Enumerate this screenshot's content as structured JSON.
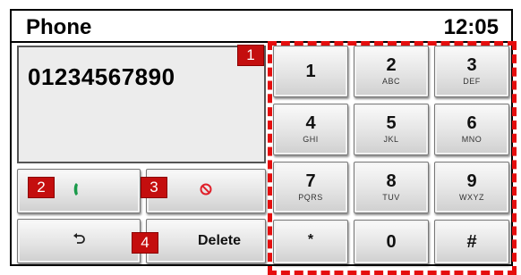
{
  "header": {
    "title": "Phone",
    "clock": "12:05"
  },
  "display": {
    "number": "01234567890"
  },
  "keypad": {
    "keys": [
      {
        "digit": "1",
        "letters": ""
      },
      {
        "digit": "2",
        "letters": "ABC"
      },
      {
        "digit": "3",
        "letters": "DEF"
      },
      {
        "digit": "4",
        "letters": "GHI"
      },
      {
        "digit": "5",
        "letters": "JKL"
      },
      {
        "digit": "6",
        "letters": "MNO"
      },
      {
        "digit": "7",
        "letters": "PQRS"
      },
      {
        "digit": "8",
        "letters": "TUV"
      },
      {
        "digit": "9",
        "letters": "WXYZ"
      },
      {
        "digit": "*",
        "letters": ""
      },
      {
        "digit": "0",
        "letters": ""
      },
      {
        "digit": "#",
        "letters": ""
      }
    ]
  },
  "controls": {
    "call_icon": "phone-handset-icon",
    "call_color": "#1a9a4a",
    "hangup_icon": "no-entry-icon",
    "hangup_color": "#e0202a",
    "back_icon": "undo-arrow-icon",
    "delete_label": "Delete"
  },
  "markers": [
    "1",
    "2",
    "3",
    "4"
  ],
  "colors": {
    "marker": "#c40e0e",
    "dashed_outline": "#e50d0d"
  }
}
